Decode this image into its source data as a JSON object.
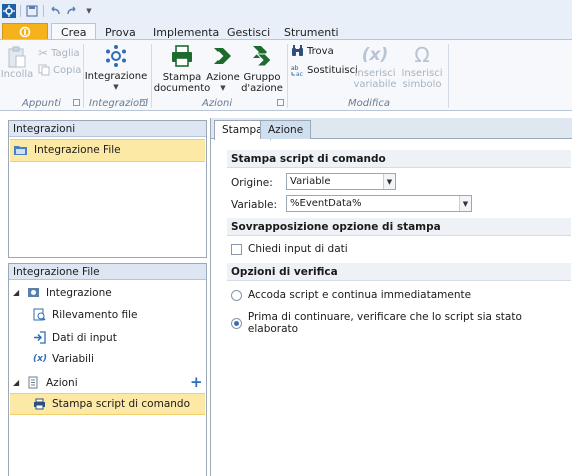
{
  "ribbon_tabs": {
    "crea": "Crea",
    "prova": "Prova",
    "implementa": "Implementa",
    "gestisci": "Gestisci",
    "strumenti": "Strumenti"
  },
  "groups": {
    "appunti": {
      "label": "Appunti",
      "incolla": "Incolla",
      "taglia": "Taglia",
      "copia": "Copia"
    },
    "integrazioni": {
      "label": "Integrazioni",
      "integrazione_line1": "Integrazione"
    },
    "azioni": {
      "label": "Azioni",
      "stampa_line1": "Stampa",
      "stampa_line2": "documento",
      "azione": "Azione",
      "gruppo_line1": "Gruppo",
      "gruppo_line2": "d'azione"
    },
    "modifica": {
      "label": "Modifica",
      "trova": "Trova",
      "sostituisci": "Sostituisci",
      "inserisci_variabile_line1": "Inserisci",
      "inserisci_variabile_line2": "variabile",
      "inserisci_simbolo_line1": "Inserisci",
      "inserisci_simbolo_line2": "simbolo"
    }
  },
  "left_top": {
    "title": "Integrazioni",
    "item": "Integrazione File"
  },
  "left_bottom": {
    "title": "Integrazione File",
    "integrazione": "Integrazione",
    "rilevamento": "Rilevamento file",
    "dati_input": "Dati di input",
    "variabili": "Variabili",
    "azioni": "Azioni",
    "stampa_script": "Stampa script di comando"
  },
  "right": {
    "tab_stampa": "Stampa",
    "tab_azione": "Azione",
    "section1": "Stampa script di comando",
    "origine_label": "Origine:",
    "origine_value": "Variable",
    "variabile_label": "Variable:",
    "variabile_value": "%EventData%",
    "section2": "Sovrapposizione opzione di stampa",
    "chiedi_input": "Chiedi input di dati",
    "chiedi_input_checked": false,
    "section3": "Opzioni di verifica",
    "radio1": "Accoda script e continua immediatamente",
    "radio2": "Prima di continuare, verificare che lo script sia stato elaborato",
    "radio_selected": 2
  },
  "colors": {
    "accent": "#2f6eb5",
    "file_button": "#f6b21a",
    "selection": "#fde9a6",
    "green_icon": "#1e6b2e"
  }
}
